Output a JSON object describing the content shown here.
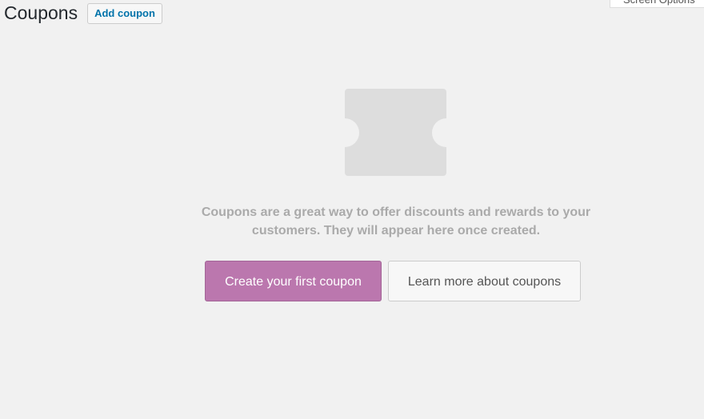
{
  "header": {
    "title": "Coupons",
    "add_label": "Add coupon",
    "screen_options": "Screen Options"
  },
  "empty": {
    "message": "Coupons are a great way to offer discounts and rewards to your customers. They will appear here once created.",
    "primary_label": "Create your first coupon",
    "secondary_label": "Learn more about coupons"
  }
}
